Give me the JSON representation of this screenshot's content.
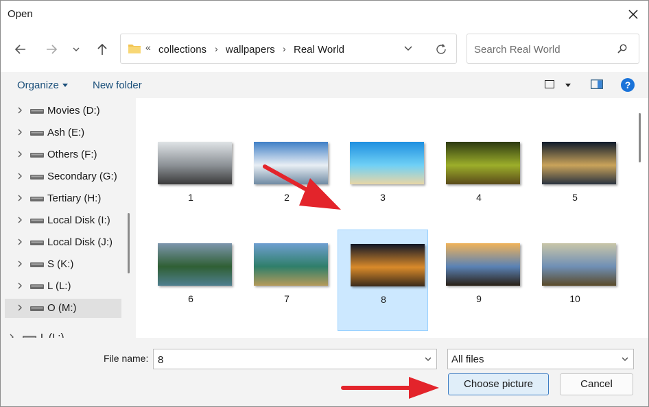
{
  "window": {
    "title": "Open"
  },
  "address": {
    "breadcrumbs": [
      "collections",
      "wallpapers",
      "Real World"
    ],
    "overflow_glyph": "«"
  },
  "search": {
    "placeholder": "Search Real World"
  },
  "toolbar": {
    "organize": "Organize",
    "new_folder": "New folder",
    "help_glyph": "?"
  },
  "nav": {
    "drives": [
      {
        "label": "Movies (D:)"
      },
      {
        "label": "Ash (E:)"
      },
      {
        "label": "Others (F:)"
      },
      {
        "label": "Secondary (G:)"
      },
      {
        "label": "Tertiary (H:)"
      },
      {
        "label": "Local Disk (I:)"
      },
      {
        "label": "Local Disk (J:)"
      },
      {
        "label": "S (K:)"
      },
      {
        "label": "L (L:)"
      },
      {
        "label": "O (M:)",
        "selected": true
      }
    ],
    "partial_drive": "L (L:)"
  },
  "files": [
    {
      "name": "1",
      "colors": [
        "#dfe3e6",
        "#8c9196",
        "#3a3a3a"
      ]
    },
    {
      "name": "2",
      "colors": [
        "#3f7fc6",
        "#e8eef4",
        "#6f8aa3"
      ]
    },
    {
      "name": "3",
      "colors": [
        "#1f8fe0",
        "#6fd0f5",
        "#e8d6a6"
      ]
    },
    {
      "name": "4",
      "colors": [
        "#2d3a12",
        "#9cae2a",
        "#5a4a1a"
      ]
    },
    {
      "name": "5",
      "colors": [
        "#0f1b2c",
        "#c9a35a",
        "#2a3340"
      ]
    },
    {
      "name": "6",
      "colors": [
        "#7d96ad",
        "#2f5f34",
        "#4f7f8f"
      ]
    },
    {
      "name": "7",
      "colors": [
        "#6f9fd0",
        "#2f7f6a",
        "#b59a5a"
      ]
    },
    {
      "name": "8",
      "colors": [
        "#101626",
        "#d98a2a",
        "#3a2a1a"
      ],
      "selected": true
    },
    {
      "name": "9",
      "colors": [
        "#f0b35a",
        "#5a82b5",
        "#2a2016"
      ]
    },
    {
      "name": "10",
      "colors": [
        "#c9c6a8",
        "#6f8fb5",
        "#5a4a2a"
      ]
    }
  ],
  "footer": {
    "file_name_label": "File name:",
    "file_name_value": "8",
    "filter_value": "All files",
    "choose_label": "Choose picture",
    "cancel_label": "Cancel"
  },
  "colors": {
    "accent": "#1a73d9",
    "selection": "#cce8ff",
    "arrow": "#e3242b"
  }
}
